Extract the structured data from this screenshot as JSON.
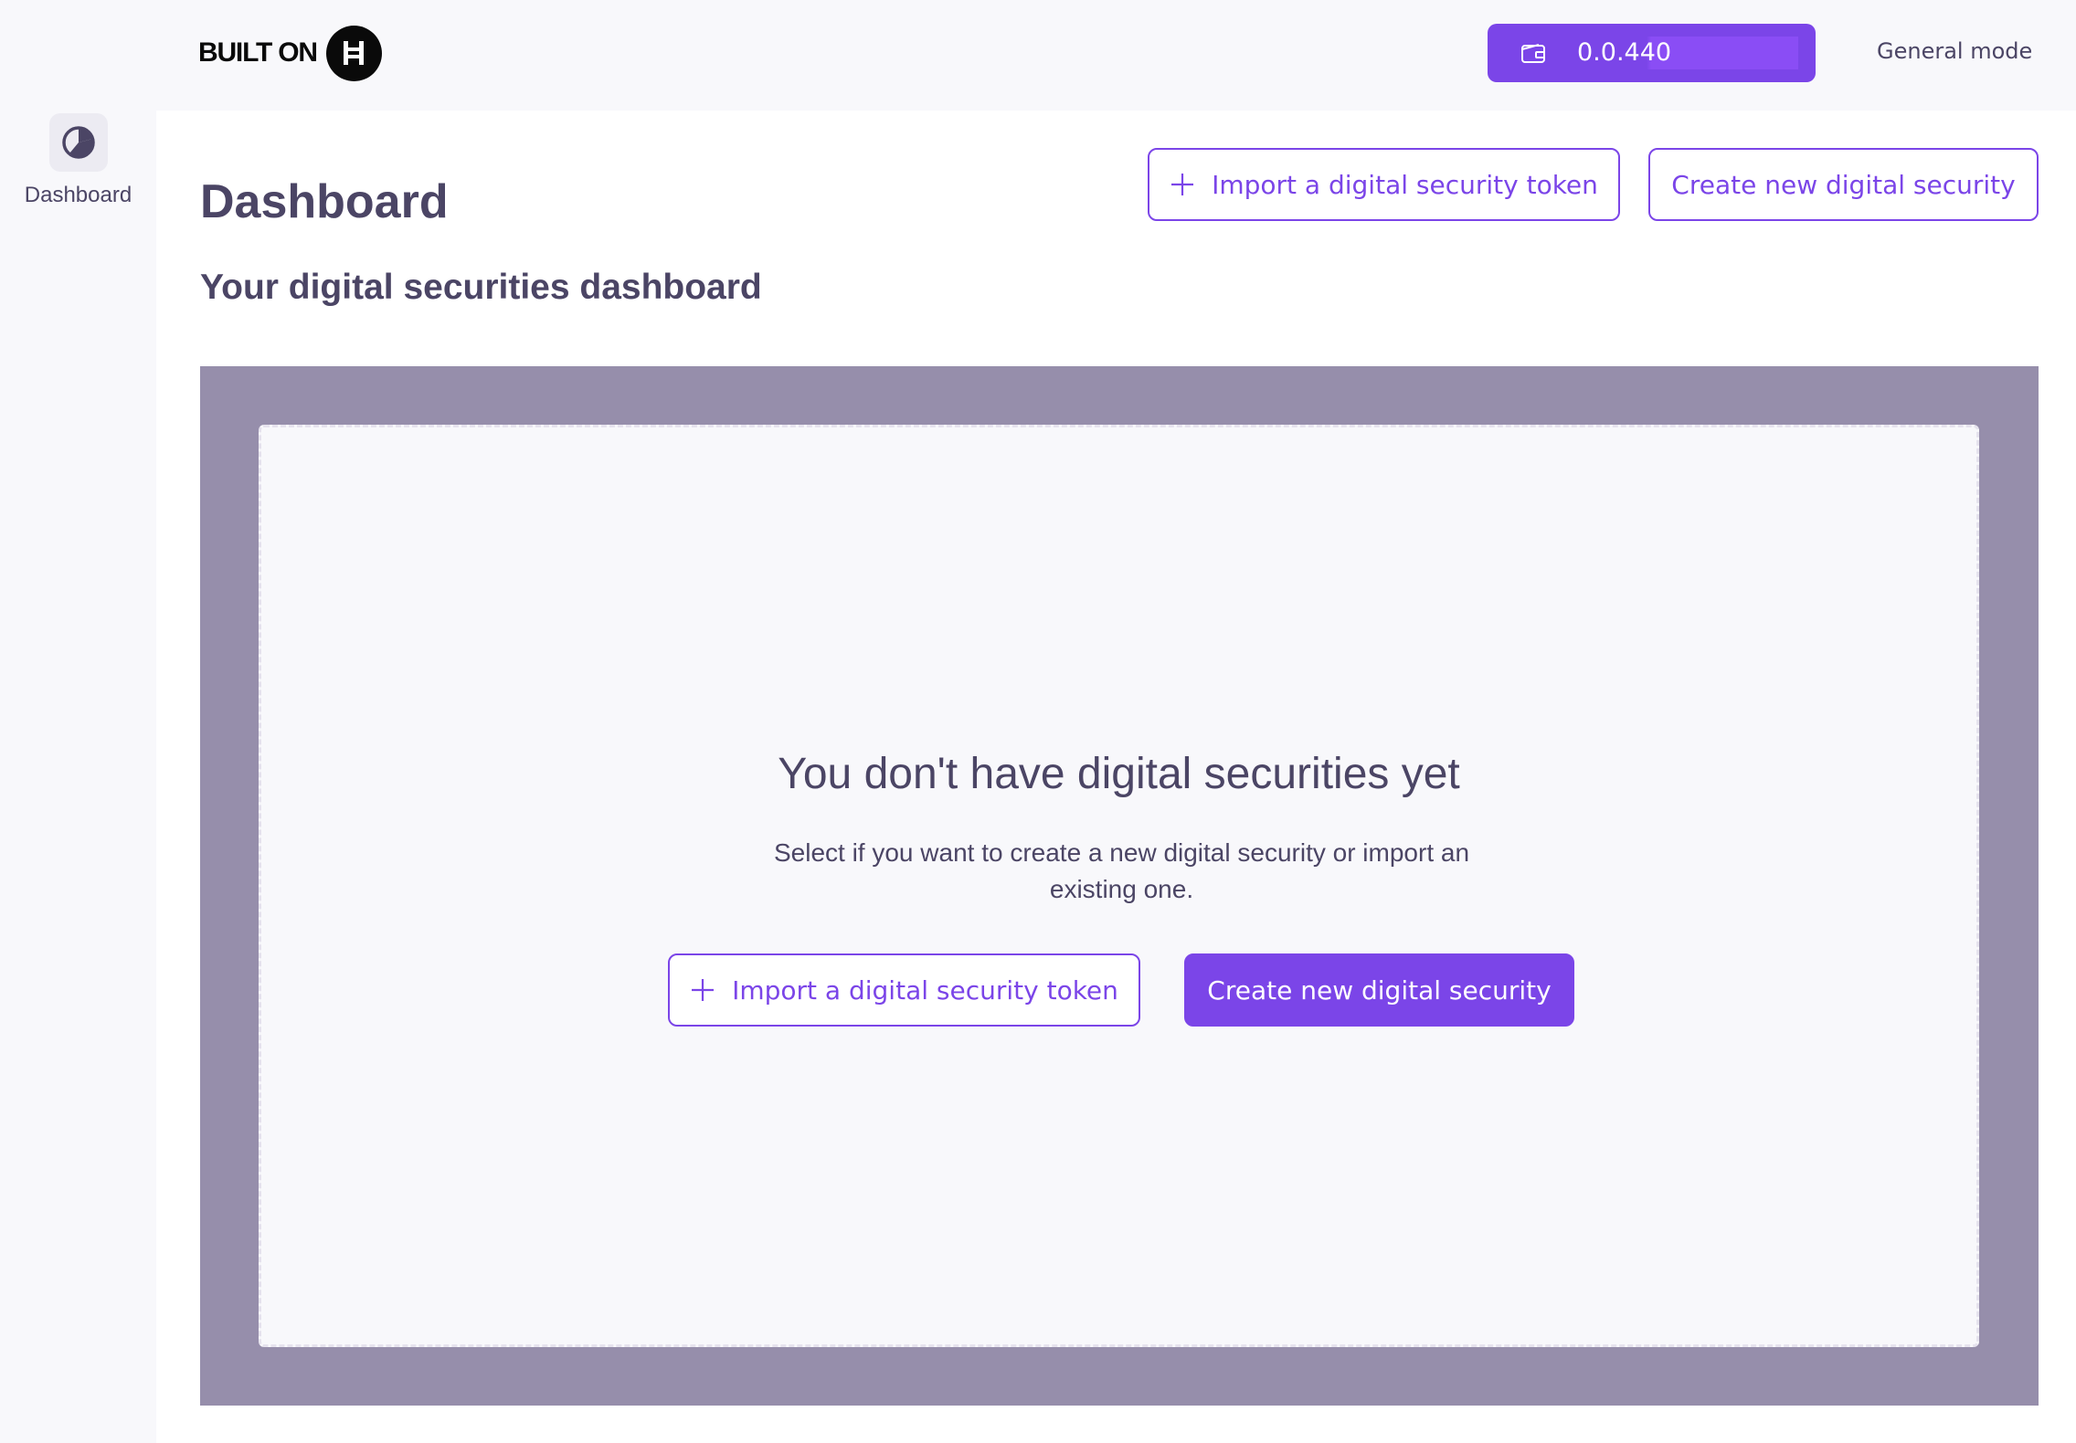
{
  "header": {
    "logo_text": "BUILT ON",
    "wallet": {
      "icon": "wallet-icon",
      "value": "0.0.440"
    },
    "mode_label": "General mode"
  },
  "sidebar": {
    "items": [
      {
        "label": "Dashboard",
        "icon": "pie-chart-icon"
      }
    ]
  },
  "main": {
    "title": "Dashboard",
    "subtitle": "Your digital securities dashboard",
    "actions": {
      "import_label": "Import a digital security token",
      "create_label": "Create new digital security"
    },
    "empty_state": {
      "title": "You don't have digital securities yet",
      "description": "Select if you want to create a new digital security or import an existing one.",
      "import_label": "Import a digital security token",
      "create_label": "Create new digital security"
    }
  },
  "colors": {
    "accent": "#7b45e8",
    "text": "#4b4565",
    "overlay": "#968eab",
    "background": "#f8f8fb"
  }
}
